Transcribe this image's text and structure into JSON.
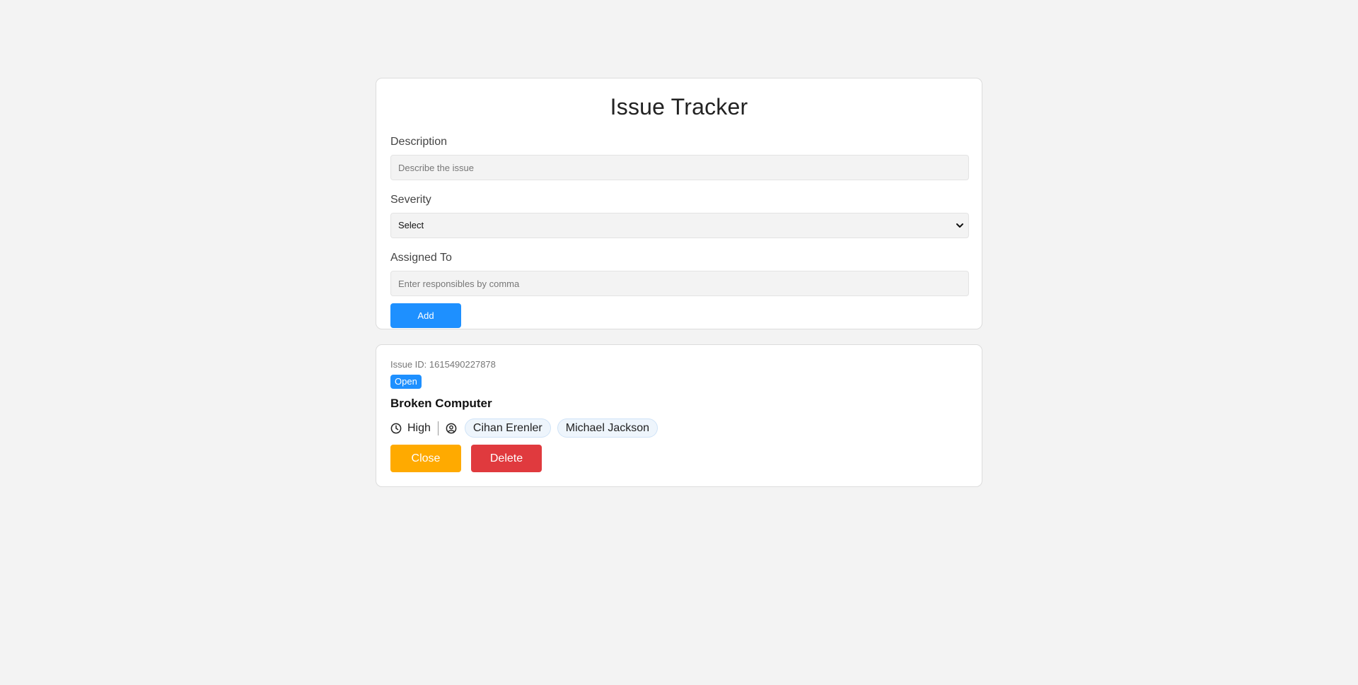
{
  "app": {
    "title": "Issue Tracker"
  },
  "form": {
    "description_label": "Description",
    "description_placeholder": "Describe the issue",
    "severity_label": "Severity",
    "severity_selected": "Select",
    "assigned_label": "Assigned To",
    "assigned_placeholder": "Enter responsibles by comma",
    "add_label": "Add"
  },
  "issues": [
    {
      "id_text": "Issue ID: 1615490227878",
      "status": "Open",
      "title": "Broken Computer",
      "severity": "High",
      "assignees": [
        "Cihan Erenler",
        "Michael Jackson"
      ],
      "close_label": "Close",
      "delete_label": "Delete"
    }
  ],
  "icons": {
    "severity": "clock-icon",
    "assignees": "user-circle-icon",
    "select": "chevron-down-icon"
  },
  "colors": {
    "primary": "#1e90ff",
    "warning": "#ffaa00",
    "danger": "#e03a3e",
    "background": "#f3f3f3"
  }
}
